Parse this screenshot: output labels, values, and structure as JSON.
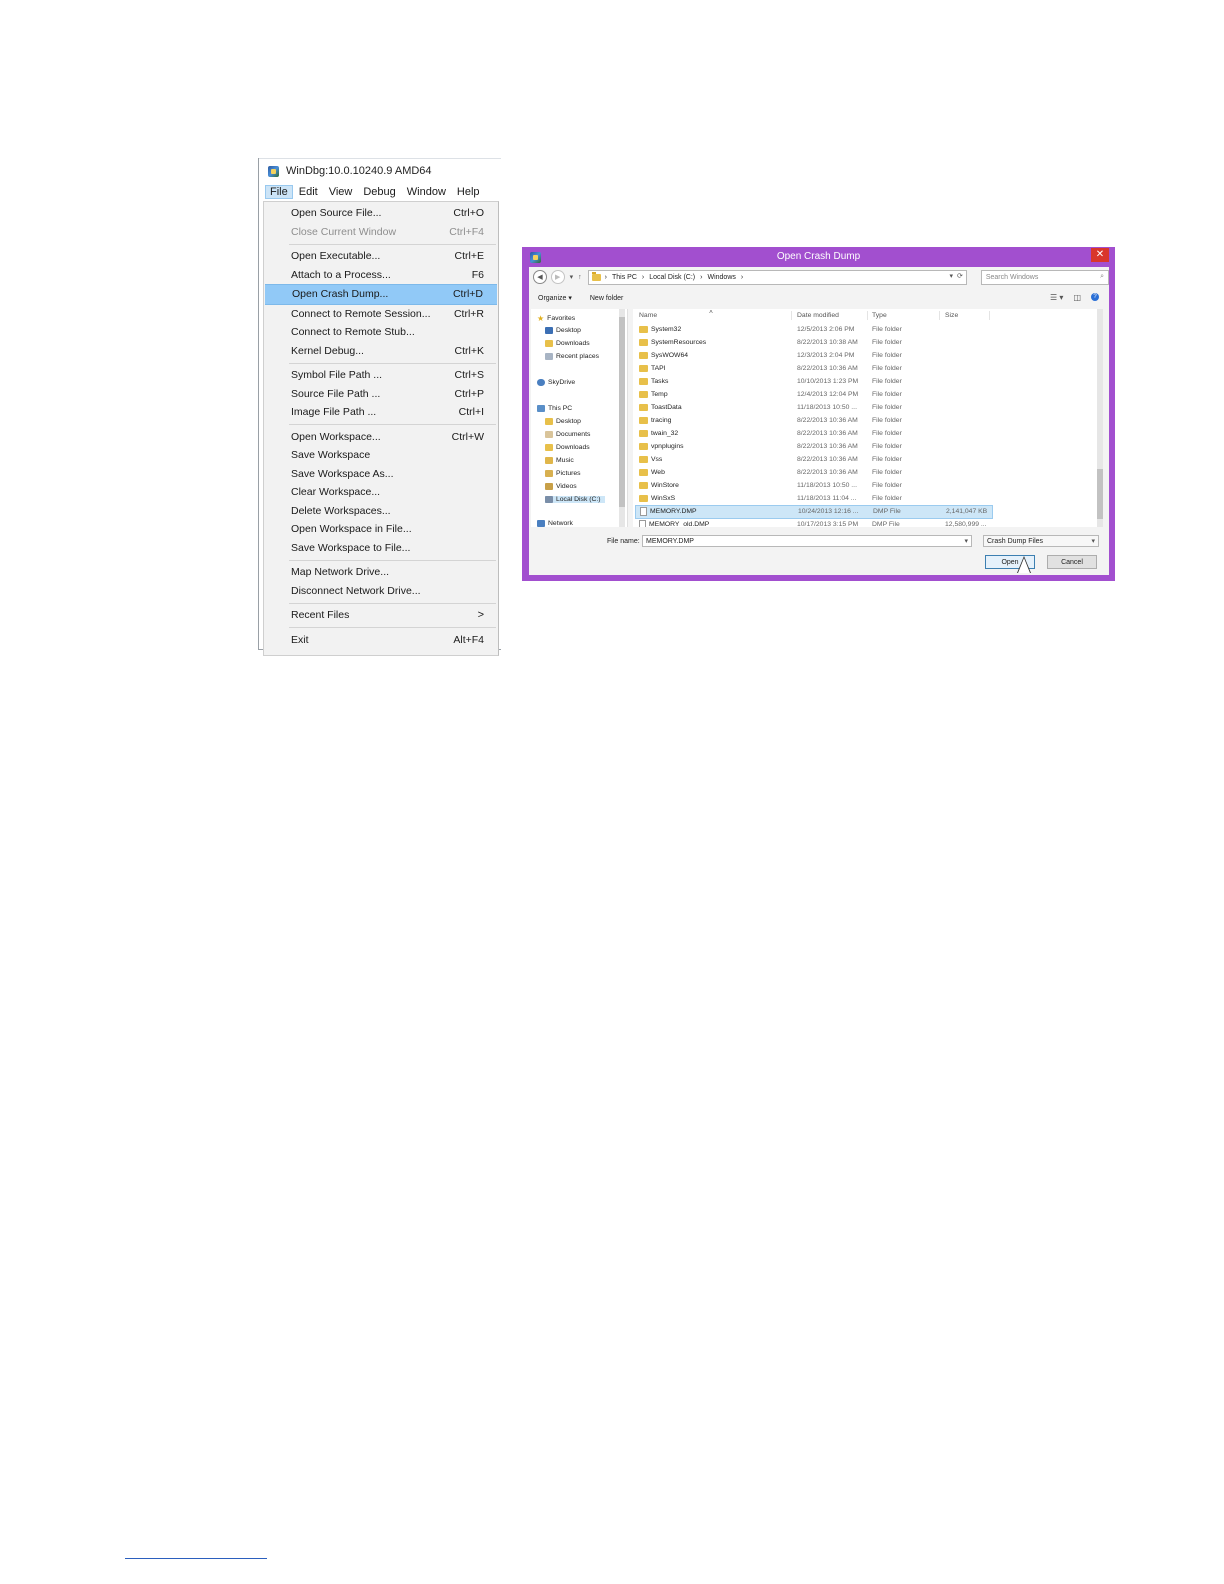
{
  "windbg": {
    "title": "WinDbg:10.0.10240.9 AMD64",
    "menubar": [
      "File",
      "Edit",
      "View",
      "Debug",
      "Window",
      "Help"
    ],
    "file_menu": [
      {
        "label": "Open Source File...",
        "shortcut": "Ctrl+O"
      },
      {
        "label": "Close Current Window",
        "shortcut": "Ctrl+F4",
        "disabled": true
      },
      {
        "label": "Open Executable...",
        "shortcut": "Ctrl+E"
      },
      {
        "label": "Attach to a Process...",
        "shortcut": "F6"
      },
      {
        "label": "Open Crash Dump...",
        "shortcut": "Ctrl+D",
        "highlighted": true
      },
      {
        "label": "Connect to Remote Session...",
        "shortcut": "Ctrl+R"
      },
      {
        "label": "Connect to Remote Stub...",
        "shortcut": ""
      },
      {
        "label": "Kernel Debug...",
        "shortcut": "Ctrl+K"
      },
      {
        "label": "Symbol File Path ...",
        "shortcut": "Ctrl+S"
      },
      {
        "label": "Source File Path ...",
        "shortcut": "Ctrl+P"
      },
      {
        "label": "Image File Path ...",
        "shortcut": "Ctrl+I"
      },
      {
        "label": "Open Workspace...",
        "shortcut": "Ctrl+W"
      },
      {
        "label": "Save Workspace",
        "shortcut": ""
      },
      {
        "label": "Save Workspace As...",
        "shortcut": ""
      },
      {
        "label": "Clear Workspace...",
        "shortcut": ""
      },
      {
        "label": "Delete Workspaces...",
        "shortcut": ""
      },
      {
        "label": "Open Workspace in File...",
        "shortcut": ""
      },
      {
        "label": "Save Workspace to File...",
        "shortcut": ""
      },
      {
        "label": "Map Network Drive...",
        "shortcut": ""
      },
      {
        "label": "Disconnect Network Drive...",
        "shortcut": ""
      },
      {
        "label": "Recent Files",
        "shortcut": ">"
      },
      {
        "label": "Exit",
        "shortcut": "Alt+F4"
      }
    ]
  },
  "dialog": {
    "title": "Open Crash Dump",
    "close_glyph": "✕",
    "breadcrumbs": [
      "This PC",
      "Local Disk (C:)",
      "Windows"
    ],
    "search_placeholder": "Search Windows",
    "toolbar": {
      "organize": "Organize ▾",
      "new_folder": "New folder"
    },
    "nav": {
      "favorites": "Favorites",
      "favorites_items": [
        "Desktop",
        "Downloads",
        "Recent places"
      ],
      "skydrive": "SkyDrive",
      "this_pc": "This PC",
      "this_pc_items": [
        "Desktop",
        "Documents",
        "Downloads",
        "Music",
        "Pictures",
        "Videos",
        "Local Disk (C:)"
      ],
      "network": "Network"
    },
    "columns": {
      "name": "Name",
      "date": "Date modified",
      "type": "Type",
      "size": "Size"
    },
    "files": [
      {
        "name": "System32",
        "date": "12/5/2013 2:06 PM",
        "type": "File folder",
        "size": "",
        "kind": "folder"
      },
      {
        "name": "SystemResources",
        "date": "8/22/2013 10:38 AM",
        "type": "File folder",
        "size": "",
        "kind": "folder"
      },
      {
        "name": "SysWOW64",
        "date": "12/3/2013 2:04 PM",
        "type": "File folder",
        "size": "",
        "kind": "folder"
      },
      {
        "name": "TAPI",
        "date": "8/22/2013 10:36 AM",
        "type": "File folder",
        "size": "",
        "kind": "folder"
      },
      {
        "name": "Tasks",
        "date": "10/10/2013 1:23 PM",
        "type": "File folder",
        "size": "",
        "kind": "folder"
      },
      {
        "name": "Temp",
        "date": "12/4/2013 12:04 PM",
        "type": "File folder",
        "size": "",
        "kind": "folder"
      },
      {
        "name": "ToastData",
        "date": "11/18/2013 10:50 ...",
        "type": "File folder",
        "size": "",
        "kind": "folder"
      },
      {
        "name": "tracing",
        "date": "8/22/2013 10:36 AM",
        "type": "File folder",
        "size": "",
        "kind": "folder"
      },
      {
        "name": "twain_32",
        "date": "8/22/2013 10:36 AM",
        "type": "File folder",
        "size": "",
        "kind": "folder"
      },
      {
        "name": "vpnplugins",
        "date": "8/22/2013 10:36 AM",
        "type": "File folder",
        "size": "",
        "kind": "folder"
      },
      {
        "name": "Vss",
        "date": "8/22/2013 10:36 AM",
        "type": "File folder",
        "size": "",
        "kind": "folder"
      },
      {
        "name": "Web",
        "date": "8/22/2013 10:36 AM",
        "type": "File folder",
        "size": "",
        "kind": "folder"
      },
      {
        "name": "WinStore",
        "date": "11/18/2013 10:50 ...",
        "type": "File folder",
        "size": "",
        "kind": "folder"
      },
      {
        "name": "WinSxS",
        "date": "11/18/2013 11:04 ...",
        "type": "File folder",
        "size": "",
        "kind": "folder"
      },
      {
        "name": "MEMORY.DMP",
        "date": "10/24/2013 12:16 ...",
        "type": "DMP File",
        "size": "2,141,047 KB",
        "kind": "file",
        "selected": true
      },
      {
        "name": "MEMORY_old.DMP",
        "date": "10/17/2013 3:15 PM",
        "type": "DMP File",
        "size": "12,580,999 ...",
        "kind": "file"
      }
    ],
    "file_name_label": "File name:",
    "file_name_value": "MEMORY.DMP",
    "file_type": "Crash Dump Files",
    "open_label": "Open",
    "cancel_label": "Cancel"
  },
  "colors": {
    "dialog_frame": "#a24fcf",
    "menu_highlight": "#91c9f7",
    "close_button": "#d9362b"
  }
}
